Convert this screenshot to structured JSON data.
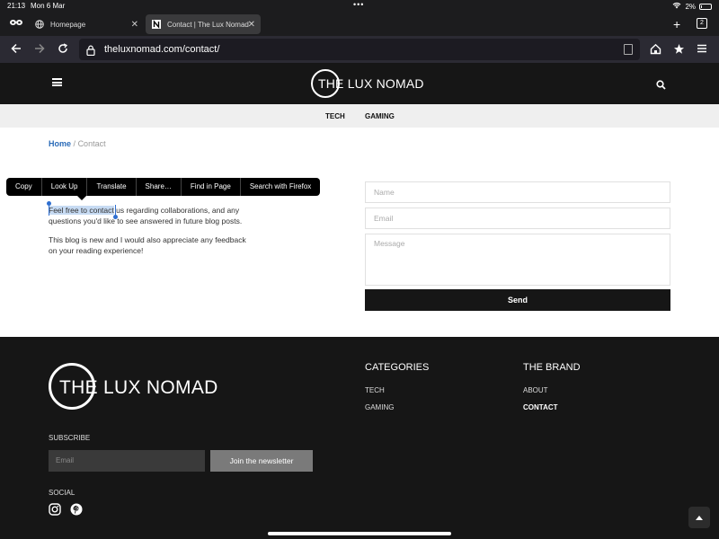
{
  "status": {
    "time": "21:13",
    "date": "Mon 6 Mar",
    "battery": "2%"
  },
  "tabs": [
    {
      "label": "Homepage",
      "icon": "globe-icon"
    },
    {
      "label": "Contact | The Lux Nomad",
      "icon": "site-favicon"
    }
  ],
  "tab_count": "2",
  "url": "theluxnomad.com/contact/",
  "site": {
    "logo_text": "THE LUX NOMAD",
    "categories": [
      "TECH",
      "GAMING"
    ]
  },
  "breadcrumb": {
    "home": "Home",
    "separator": "/",
    "current": "Contact"
  },
  "context_menu": [
    "Copy",
    "Look Up",
    "Translate",
    "Share…",
    "Find in Page",
    "Search with Firefox"
  ],
  "content": {
    "para1_selected": "Feel free to contact",
    "para1_rest": " us regarding collaborations, and any questions you'd like to see answered in future blog posts.",
    "para2": "This blog is new and I would also appreciate any feedback on your reading experience!"
  },
  "form": {
    "name_placeholder": "Name",
    "email_placeholder": "Email",
    "message_placeholder": "Message",
    "send_label": "Send"
  },
  "footer": {
    "logo_text": "THE LUX NOMAD",
    "categories_heading": "CATEGORIES",
    "categories": [
      "TECH",
      "GAMING"
    ],
    "brand_heading": "THE BRAND",
    "brand_links": [
      "ABOUT",
      "CONTACT"
    ],
    "subscribe_label": "SUBSCRIBE",
    "email_placeholder": "Email",
    "join_label": "Join the newsletter",
    "social_label": "SOCIAL"
  },
  "colors": {
    "accent_link": "#2a6bb8",
    "selection": "#c7dbf3",
    "dark": "#161616"
  }
}
